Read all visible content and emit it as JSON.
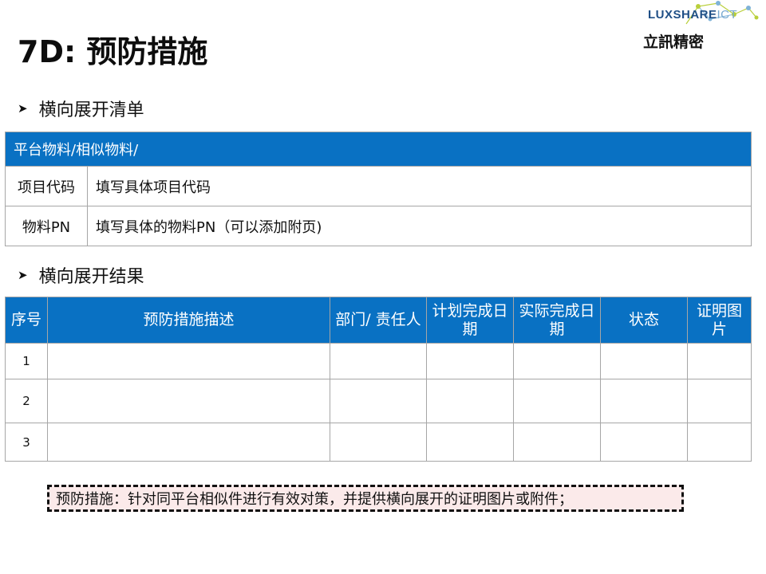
{
  "title": "7D: 预防措施",
  "logo": {
    "brand": "LUXSHARE",
    "brand_suffix": "ICT",
    "subtitle": "立訊精密"
  },
  "section1": {
    "heading": "横向展开清单"
  },
  "table1": {
    "header": "平台物料/相似物料/",
    "rows": [
      {
        "label": "项目代码",
        "value": "填写具体项目代码"
      },
      {
        "label": "物料PN",
        "value": "填写具体的物料PN（可以添加附页)"
      }
    ]
  },
  "section2": {
    "heading": "横向展开结果"
  },
  "table2": {
    "headers": [
      "序号",
      "预防措施描述",
      "部门/ 责任人",
      "计划完成日期",
      "实际完成日期",
      "状态",
      "证明图片"
    ],
    "rows": [
      {
        "no": "1"
      },
      {
        "no": "2"
      },
      {
        "no": "3"
      }
    ]
  },
  "note": "预防措施：针对同平台相似件进行有效对策，并提供横向展开的证明图片或附件；",
  "colors": {
    "header_blue": "#0971c3",
    "note_bg": "#fbeaea"
  }
}
